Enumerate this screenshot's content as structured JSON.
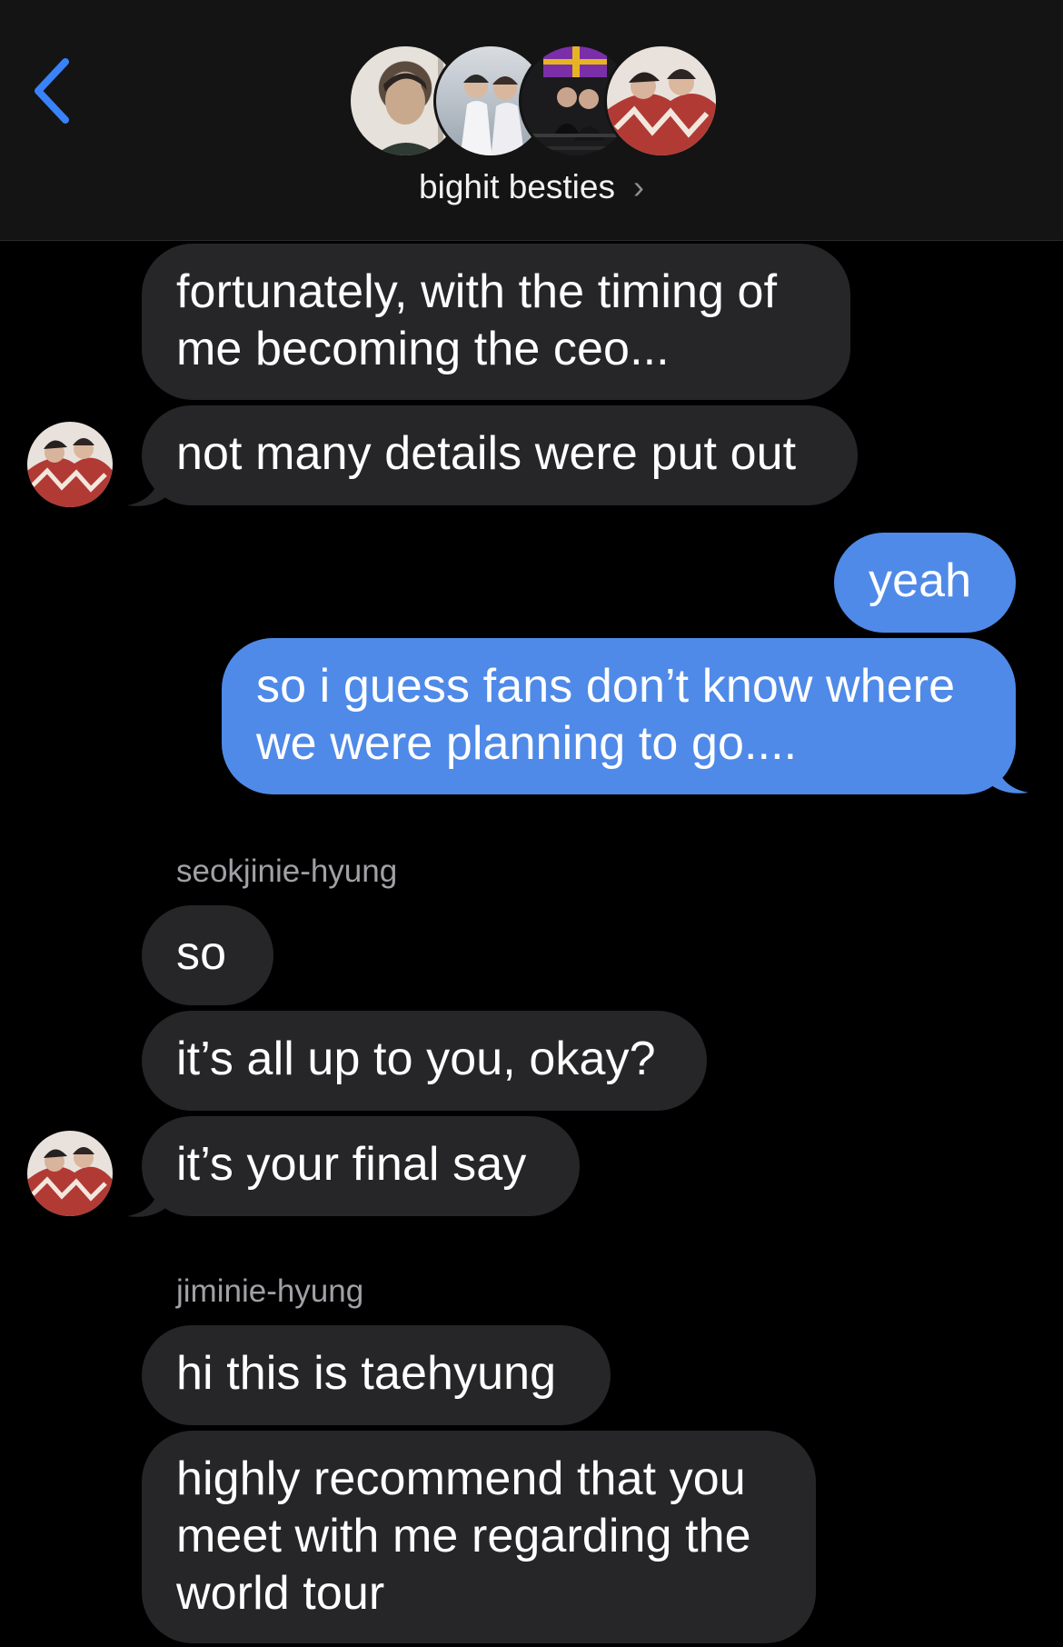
{
  "header": {
    "group_name": "bighit besties",
    "chevron": "›",
    "back_icon": "chevron-left-icon",
    "accent_color": "#3a82f7"
  },
  "messages": [
    {
      "side": "in",
      "text_lines": [
        "fortunately, with the timing of",
        "me becoming the ceo..."
      ]
    },
    {
      "side": "in",
      "text_lines": [
        "not many details were put out"
      ]
    },
    {
      "side": "out",
      "text_lines": [
        "yeah"
      ]
    },
    {
      "side": "out",
      "text_lines": [
        "so i guess fans don’t know where",
        "we were planning to go...."
      ]
    },
    {
      "side": "in",
      "sender": "seokjinie-hyung",
      "text_lines": [
        "so"
      ]
    },
    {
      "side": "in",
      "text_lines": [
        "it’s all up to you, okay?"
      ]
    },
    {
      "side": "in",
      "text_lines": [
        "it’s your final say"
      ]
    },
    {
      "side": "in",
      "sender": "jiminie-hyung",
      "text_lines": [
        "hi this is taehyung"
      ]
    },
    {
      "side": "in",
      "text_lines": [
        "highly recommend that you",
        "meet with me regarding the",
        "world tour"
      ]
    }
  ],
  "colors": {
    "incoming_bubble": "#262628",
    "outgoing_bubble": "#4f8ae8",
    "background": "#000000",
    "sender_label": "#a0a0a6"
  }
}
